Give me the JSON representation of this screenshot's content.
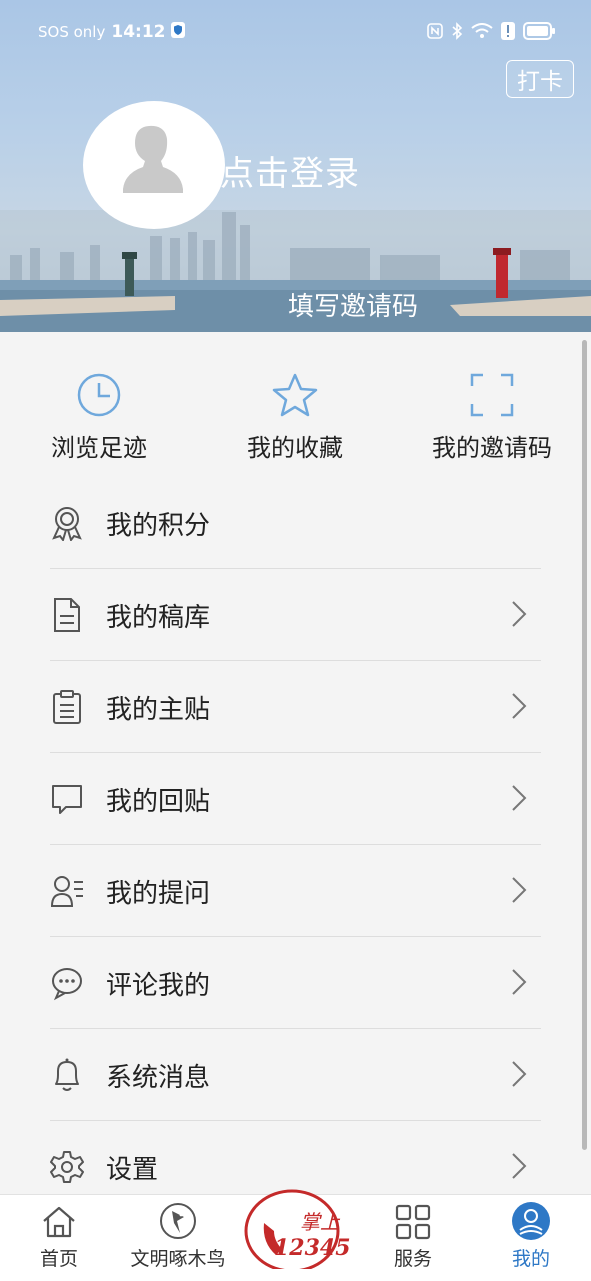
{
  "status": {
    "left_text": "SOS only",
    "time": "14:12"
  },
  "header": {
    "punch_label": "打卡",
    "login_label": "点击登录",
    "invite_label": "填写邀请码"
  },
  "quick_actions": [
    {
      "label": "浏览足迹",
      "icon": "clock-icon"
    },
    {
      "label": "我的收藏",
      "icon": "star-icon"
    },
    {
      "label": "我的邀请码",
      "icon": "scan-frame-icon"
    }
  ],
  "menu": [
    {
      "label": "我的积分",
      "icon": "medal-icon",
      "chevron": false
    },
    {
      "label": "我的稿库",
      "icon": "document-icon",
      "chevron": true
    },
    {
      "label": "我的主贴",
      "icon": "clipboard-icon",
      "chevron": true
    },
    {
      "label": "我的回贴",
      "icon": "chat-bubble-icon",
      "chevron": true
    },
    {
      "label": "我的提问",
      "icon": "user-question-icon",
      "chevron": true
    },
    {
      "label": "评论我的",
      "icon": "comment-icon",
      "chevron": true
    },
    {
      "label": "系统消息",
      "icon": "bell-icon",
      "chevron": true
    },
    {
      "label": "设置",
      "icon": "gear-icon",
      "chevron": true
    }
  ],
  "tabbar": {
    "items": [
      {
        "label": "首页",
        "icon": "home-icon"
      },
      {
        "label": "文明啄木鸟",
        "icon": "woodpecker-icon"
      },
      {
        "label": "服务",
        "icon": "grid-icon"
      },
      {
        "label": "我的",
        "icon": "profile-icon"
      }
    ],
    "center_logo_text": "掌上",
    "center_logo_number": "12345"
  },
  "colors": {
    "accent": "#2e78c6",
    "icon_light_blue": "#6fa8dc",
    "logo_red": "#c42a2a"
  }
}
